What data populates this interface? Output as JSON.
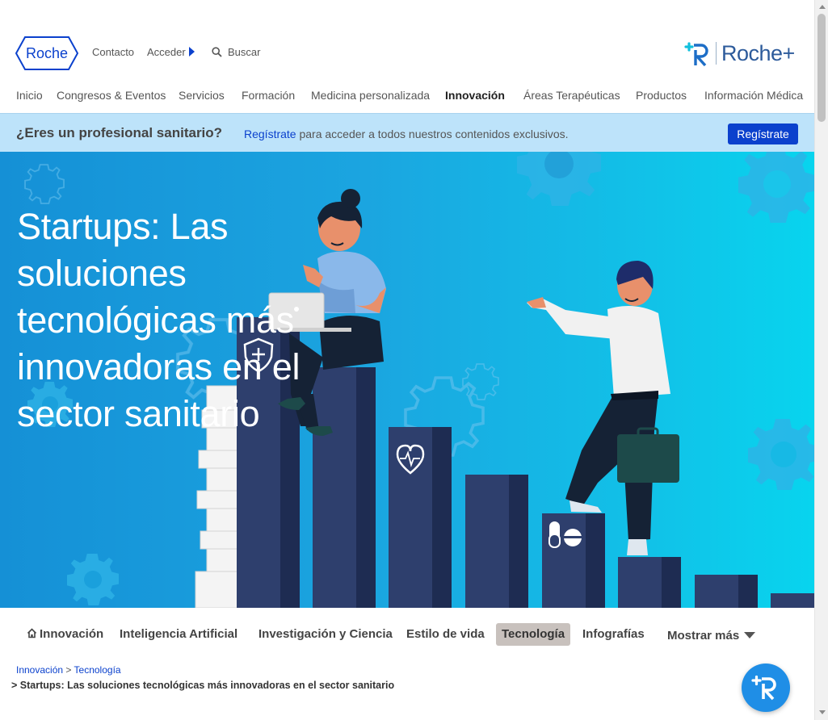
{
  "header": {
    "logo_text": "Roche",
    "contact_label": "Contacto",
    "login_label": "Acceder",
    "search_placeholder": "Buscar",
    "rocheplus_brand": "Roche+"
  },
  "main_nav": {
    "items": [
      {
        "label": "Inicio"
      },
      {
        "label": "Congresos & Eventos"
      },
      {
        "label": "Servicios"
      },
      {
        "label": "Formación"
      },
      {
        "label": "Medicina personalizada"
      },
      {
        "label": "Innovación",
        "active": true
      },
      {
        "label": "Áreas Terapéuticas"
      },
      {
        "label": "Productos"
      },
      {
        "label": "Información Médica"
      }
    ]
  },
  "pro_banner": {
    "question": "¿Eres un profesional sanitario?",
    "link_text": "Regístrate",
    "rest_text": " para acceder a todos nuestros contenidos exclusivos.",
    "button_label": "Regístrate"
  },
  "hero": {
    "title": "Startups: Las soluciones tecnológicas más innovadoras en el sector sanitario"
  },
  "category_nav": {
    "items": [
      {
        "label": "Innovación",
        "icon": "home-icon"
      },
      {
        "label": "Inteligencia Artificial"
      },
      {
        "label": "Investigación y Ciencia"
      },
      {
        "label": "Estilo de vida"
      },
      {
        "label": "Tecnología",
        "active": true
      },
      {
        "label": "Infografías"
      }
    ],
    "more_label": "Mostrar más"
  },
  "breadcrumb": {
    "items": [
      "Innovación",
      "Tecnología"
    ],
    "separator": ">",
    "current": "> Startups: Las soluciones tecnológicas más innovadoras en el sector sanitario"
  },
  "colors": {
    "brand_blue": "#0b41cd",
    "banner_bg": "#bde3fa",
    "hero_bg": "#1ba5e0",
    "active_tab_bg": "#c8c1bd"
  }
}
